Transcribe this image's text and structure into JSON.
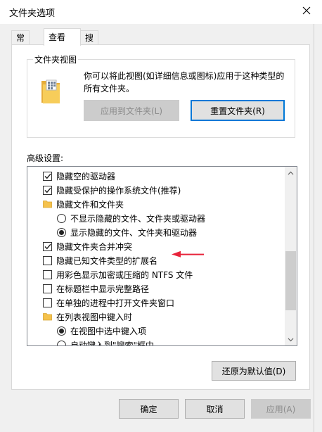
{
  "window": {
    "title": "文件夹选项"
  },
  "tabs": [
    {
      "label": "常规",
      "active": false
    },
    {
      "label": "查看",
      "active": true
    },
    {
      "label": "搜索",
      "active": false
    }
  ],
  "folder_view": {
    "title": "文件夹视图",
    "description": "你可以将此视图(如详细信息或图标)应用于这种类型的所有文件夹。",
    "apply_button": "应用到文件夹(L)",
    "reset_button": "重置文件夹(R)"
  },
  "advanced": {
    "label": "高级设置:",
    "items": [
      {
        "kind": "checkbox",
        "checked": true,
        "indent": 0,
        "label": "隐藏空的驱动器"
      },
      {
        "kind": "checkbox",
        "checked": true,
        "indent": 0,
        "label": "隐藏受保护的操作系统文件(推荐)"
      },
      {
        "kind": "folder",
        "indent": 0,
        "label": "隐藏文件和文件夹"
      },
      {
        "kind": "radio",
        "checked": false,
        "indent": 1,
        "label": "不显示隐藏的文件、文件夹或驱动器"
      },
      {
        "kind": "radio",
        "checked": true,
        "indent": 1,
        "label": "显示隐藏的文件、文件夹和驱动器"
      },
      {
        "kind": "checkbox",
        "checked": true,
        "indent": 0,
        "label": "隐藏文件夹合并冲突"
      },
      {
        "kind": "checkbox",
        "checked": false,
        "indent": 0,
        "label": "隐藏已知文件类型的扩展名"
      },
      {
        "kind": "checkbox",
        "checked": false,
        "indent": 0,
        "label": "用彩色显示加密或压缩的 NTFS 文件"
      },
      {
        "kind": "checkbox",
        "checked": false,
        "indent": 0,
        "label": "在标题栏中显示完整路径"
      },
      {
        "kind": "checkbox",
        "checked": false,
        "indent": 0,
        "label": "在单独的进程中打开文件夹窗口"
      },
      {
        "kind": "folder",
        "indent": 0,
        "label": "在列表视图中键入时"
      },
      {
        "kind": "radio",
        "checked": true,
        "indent": 1,
        "label": "在视图中选中键入项"
      },
      {
        "kind": "radio",
        "checked": false,
        "indent": 1,
        "label": "自动键入到\"搜索\"框中"
      }
    ]
  },
  "restore_button": "还原为默认值(D)",
  "footer": {
    "ok": "确定",
    "cancel": "取消",
    "apply": "应用(A)"
  },
  "colors": {
    "accent": "#0078d7",
    "annotation_arrow": "#e8233a",
    "folder": "#f5c24c"
  }
}
